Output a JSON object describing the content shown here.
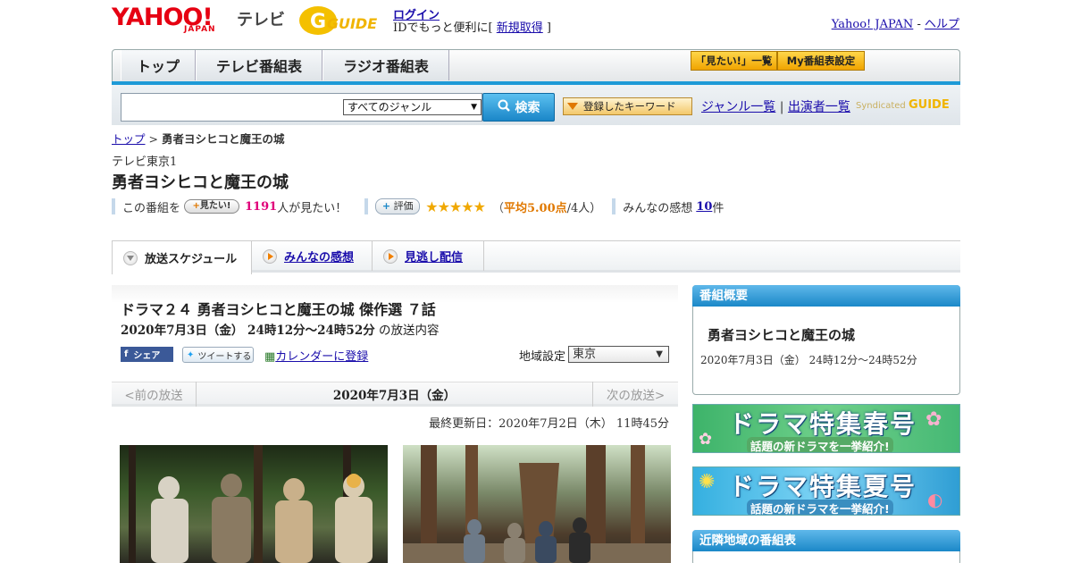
{
  "header": {
    "logo_text": "YAHOO!",
    "logo_sub": "JAPAN",
    "logo_tv": "テレビ",
    "gguide_text": "GUIDE",
    "login": "ログイン",
    "login_prefix": "IDでもっと便利に[ ",
    "register": "新規取得",
    "login_suffix": " ]",
    "yahoo_japan": "Yahoo! JAPAN",
    "separator": " - ",
    "help": "ヘルプ"
  },
  "nav": {
    "tabs": [
      "トップ",
      "テレビ番組表",
      "ラジオ番組表"
    ],
    "mitai_list": "「見たい!」一覧",
    "my_schedule": "My番組表設定"
  },
  "search": {
    "placeholder": "",
    "genre": "すべてのジャンル",
    "button": "検索",
    "keyword_button": "登録したキーワード",
    "genre_list": "ジャンル一覧",
    "divider": " | ",
    "cast_list": "出演者一覧",
    "syndicated": "Syndicated"
  },
  "breadcrumb": {
    "top": "トップ",
    "sep": " > ",
    "current": "勇者ヨシヒコと魔王の城"
  },
  "program": {
    "station": "テレビ東京1",
    "title": "勇者ヨシヒコと魔王の城",
    "mitai_prefix": "この番組を",
    "mitai_button": "見たい!",
    "mitai_count": "1191",
    "mitai_suffix": "人が見たい！",
    "rating_button": "評価",
    "stars": "★★★★★",
    "rating_open": "（",
    "rating_avg": "平均5.00点",
    "rating_people": "/4人）",
    "reviews_prefix": "みんなの感想",
    "reviews_count": "10",
    "reviews_suffix": "件"
  },
  "tabs": {
    "schedule": "放送スケジュール",
    "reviews": "みんなの感想",
    "stream": "見逃し配信"
  },
  "episode": {
    "title": "ドラマ２４ 勇者ヨシヒコと魔王の城 傑作選 ７話",
    "datetime": "2020年7月3日（金）  24時12分～24時52分",
    "datetime_suffix": "の放送内容",
    "share": "シェア",
    "tweet": "ツイートする",
    "calendar": "カレンダーに登録",
    "region_label": "地域設定",
    "region_value": "東京"
  },
  "datenav": {
    "prev": "<前の放送",
    "current": "2020年7月3日（金）",
    "next": "次の放送>"
  },
  "updated": "最終更新日：2020年7月2日（木） 11時45分",
  "sidebar": {
    "summary_head": "番組概要",
    "summary_title": "勇者ヨシヒコと魔王の城",
    "summary_time": "2020年7月3日（金） 24時12分～24時52分",
    "banner_spring": "ドラマ特集春号",
    "banner_summer": "ドラマ特集夏号",
    "banner_sub": "話題の新ドラマを一挙紹介!",
    "nearby_head": "近隣地域の番組表"
  },
  "colors": {
    "accent_blue": "#1e9ad7",
    "yahoo_red": "#e60012",
    "gguide_yellow": "#f0b400",
    "count_pink": "#e0007a"
  }
}
